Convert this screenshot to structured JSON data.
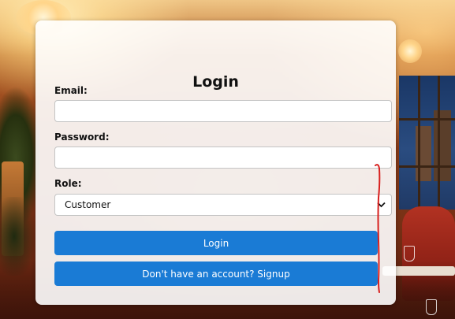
{
  "login_form": {
    "title": "Login",
    "email_label": "Email:",
    "email_value": "",
    "password_label": "Password:",
    "password_value": "",
    "role_label": "Role:",
    "role_selected": "Customer",
    "login_button": "Login",
    "signup_button": "Don't have an account? Signup"
  },
  "colors": {
    "primary_button": "#1a7bd5",
    "annotation_stroke": "#d8201e"
  },
  "icons": {
    "role_dropdown": "chevron-down-icon"
  }
}
